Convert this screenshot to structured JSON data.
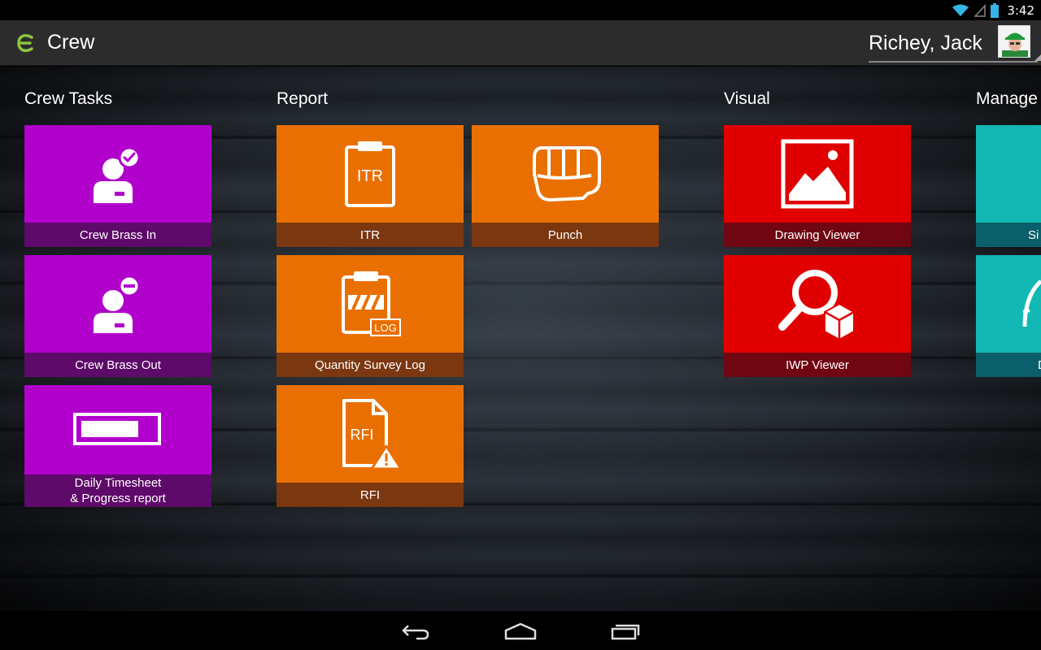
{
  "status_bar": {
    "time": "3:42",
    "icons": [
      "wifi-icon",
      "signal-icon",
      "battery-icon"
    ]
  },
  "action_bar": {
    "app_title": "Crew",
    "user_name": "Richey, Jack",
    "logo_color": "#8cc63f"
  },
  "sections": {
    "crew_tasks": "Crew Tasks",
    "report": "Report",
    "visual": "Visual",
    "manage": "Manage"
  },
  "tiles": {
    "crew_brass_in": {
      "label": "Crew Brass In",
      "icon": "person-check-icon"
    },
    "crew_brass_out": {
      "label": "Crew Brass Out",
      "icon": "person-minus-icon"
    },
    "daily_timesheet": {
      "label_line1": "Daily Timesheet",
      "label_line2": "& Progress report",
      "icon": "progress-bar-icon"
    },
    "itr": {
      "label": "ITR",
      "icon_text": "ITR",
      "icon": "clipboard-icon"
    },
    "punch": {
      "label": "Punch",
      "icon": "fist-icon"
    },
    "quantity_survey_log": {
      "label": "Quantity Survey Log",
      "icon_text": "LOG",
      "icon": "clipboard-log-icon"
    },
    "rfi": {
      "label": "RFI",
      "icon_text": "RFI",
      "icon": "document-warning-icon"
    },
    "drawing_viewer": {
      "label": "Drawing Viewer",
      "icon": "picture-icon"
    },
    "iwp_viewer": {
      "label": "IWP Viewer",
      "icon": "magnifier-cube-icon"
    },
    "manage_1": {
      "label": "Si",
      "icon": "search-icon"
    },
    "manage_2": {
      "label": "D",
      "icon": "gauge-icon"
    }
  },
  "colors": {
    "purple": "#b100cc",
    "orange": "#e96f00",
    "red": "#e00000",
    "teal": "#13b8b4"
  },
  "nav_bar": {
    "buttons": [
      "back-icon",
      "home-icon",
      "recents-icon"
    ]
  }
}
